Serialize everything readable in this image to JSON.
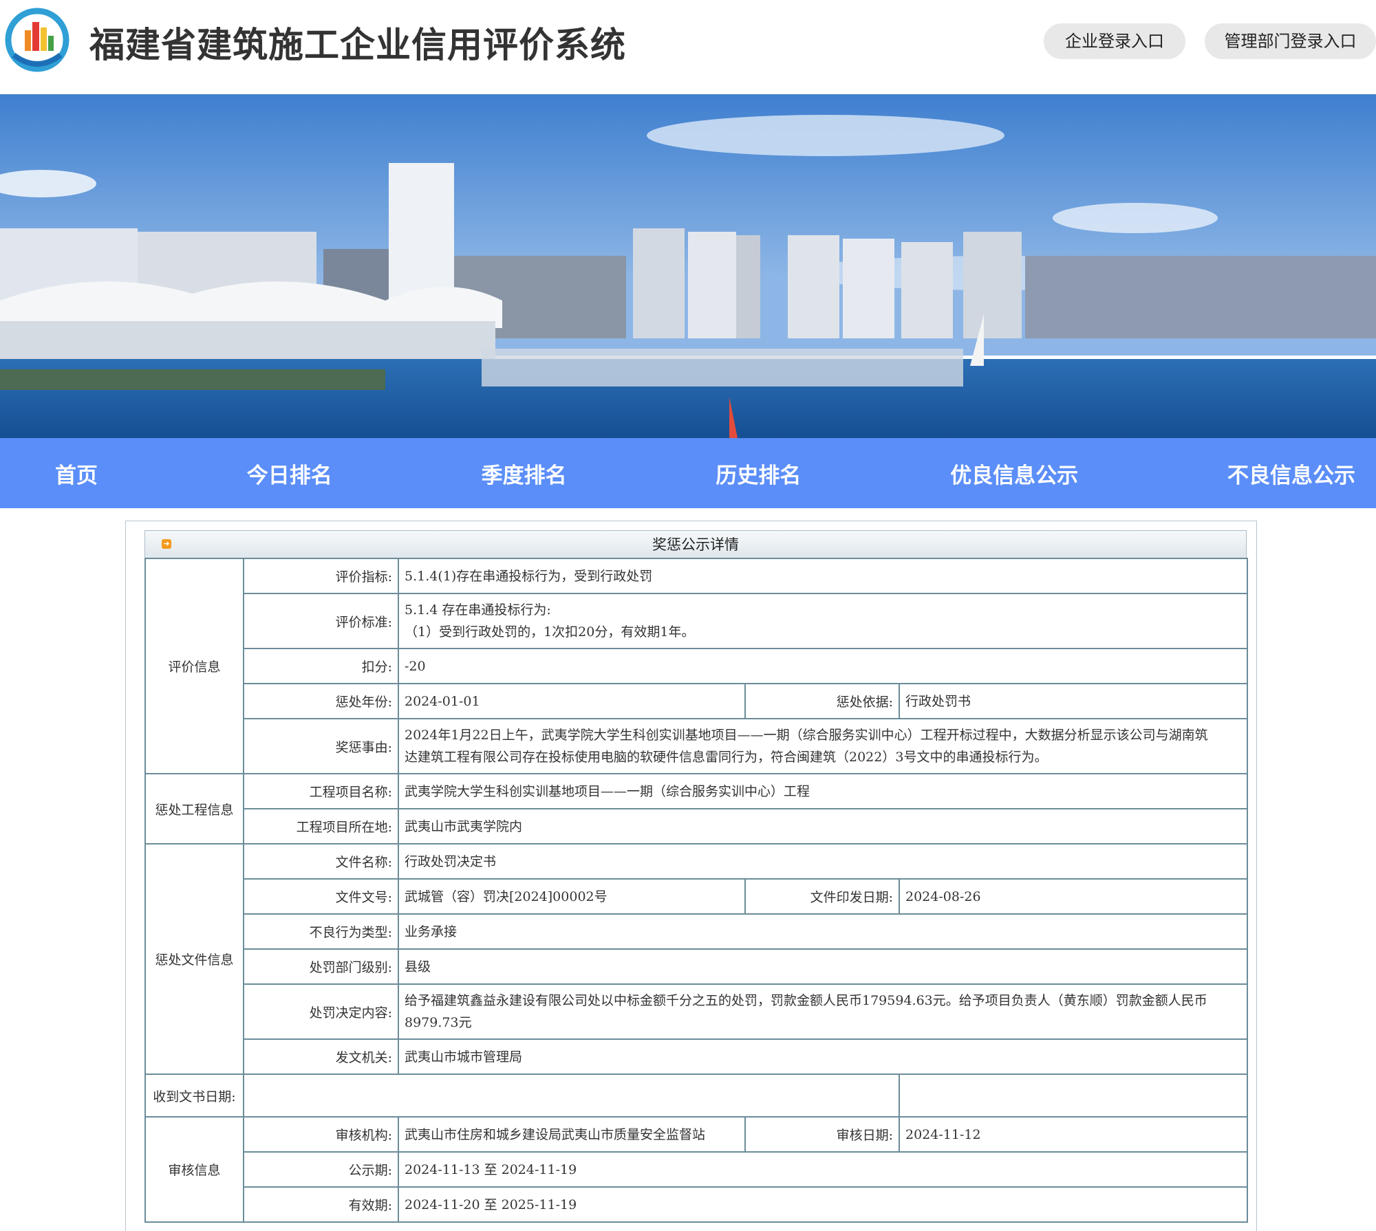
{
  "header": {
    "title": "福建省建筑施工企业信用评价系统",
    "enterprise_login": "企业登录入口",
    "admin_login": "管理部门登录入口"
  },
  "nav": [
    "首页",
    "今日排名",
    "季度排名",
    "历史排名",
    "优良信息公示",
    "不良信息公示"
  ],
  "panel": {
    "title": "奖惩公示详情"
  },
  "groups": {
    "evaluation": "评价信息",
    "project": "惩处工程信息",
    "document": "惩处文件信息",
    "received_date": "收到文书日期:",
    "review": "审核信息"
  },
  "rows": {
    "indicator": {
      "label": "评价指标:",
      "value": "5.1.4(1)存在串通投标行为，受到行政处罚"
    },
    "standard": {
      "label": "评价标准:",
      "line1": "5.1.4 存在串通投标行为:",
      "line2": "（1）受到行政处罚的，1次扣20分，有效期1年。"
    },
    "deduction": {
      "label": "扣分:",
      "value": "-20"
    },
    "year": {
      "label": "惩处年份:",
      "value": "2024-01-01"
    },
    "basis": {
      "label": "惩处依据:",
      "value": "行政处罚书"
    },
    "reason": {
      "label": "奖惩事由:",
      "line1": "2024年1月22日上午，武夷学院大学生科创实训基地项目——一期（综合服务实训中心）工程开标过程中，大数据分析显示该公司与湖南筑",
      "line2": "达建筑工程有限公司存在投标使用电脑的软硬件信息雷同行为，符合闽建筑（2022）3号文中的串通投标行为。"
    },
    "project_name": {
      "label": "工程项目名称:",
      "value": "武夷学院大学生科创实训基地项目——一期（综合服务实训中心）工程"
    },
    "project_location": {
      "label": "工程项目所在地:",
      "value": "武夷山市武夷学院内"
    },
    "doc_name": {
      "label": "文件名称:",
      "value": "行政处罚决定书"
    },
    "doc_number": {
      "label": "文件文号:",
      "value": "武城管（容）罚决[2024]00002号"
    },
    "doc_date": {
      "label": "文件印发日期:",
      "value": "2024-08-26"
    },
    "behavior_type": {
      "label": "不良行为类型:",
      "value": "业务承接"
    },
    "dept_level": {
      "label": "处罚部门级别:",
      "value": "县级"
    },
    "decision": {
      "label": "处罚决定内容:",
      "line1": "给予福建筑鑫益永建设有限公司处以中标金额千分之五的处罚，罚款金额人民币179594.63元。给予项目负责人（黄东顺）罚款金额人民币",
      "line2": "8979.73元"
    },
    "issuer": {
      "label": "发文机关:",
      "value": "武夷山市城市管理局"
    },
    "review_org": {
      "label": "审核机构:",
      "value": "武夷山市住房和城乡建设局武夷山市质量安全监督站"
    },
    "review_date": {
      "label": "审核日期:",
      "value": "2024-11-12"
    },
    "publicity": {
      "label": "公示期:",
      "value": "2024-11-13 至 2024-11-19"
    },
    "validity": {
      "label": "有效期:",
      "value": "2024-11-20 至 2025-11-19"
    }
  }
}
